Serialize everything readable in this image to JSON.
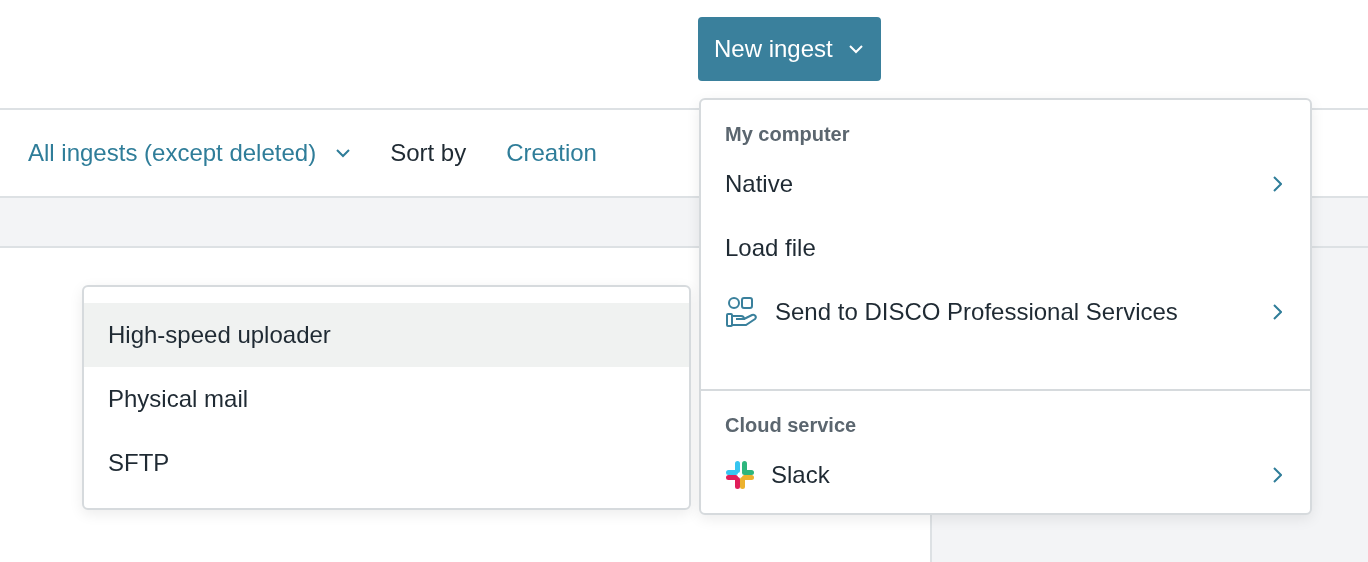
{
  "header": {
    "new_ingest_button": "New ingest"
  },
  "filter_bar": {
    "filter": "All ingests (except deleted)",
    "sort_label": "Sort by",
    "sort_value": "Creation"
  },
  "new_ingest_menu": {
    "sections": [
      {
        "title": "My computer",
        "items": [
          {
            "label": "Native",
            "kind": "plain",
            "submenu": true
          },
          {
            "label": "Load file",
            "kind": "plain",
            "submenu": false
          },
          {
            "label": "Send to DISCO Professional Services",
            "kind": "services",
            "submenu": true
          }
        ]
      },
      {
        "title": "Cloud service",
        "items": [
          {
            "label": "Slack",
            "kind": "slack",
            "submenu": true
          }
        ]
      }
    ]
  },
  "submenu": {
    "items": [
      {
        "label": "High-speed uploader",
        "selected": true
      },
      {
        "label": "Physical mail",
        "selected": false
      },
      {
        "label": "SFTP",
        "selected": false
      }
    ]
  }
}
